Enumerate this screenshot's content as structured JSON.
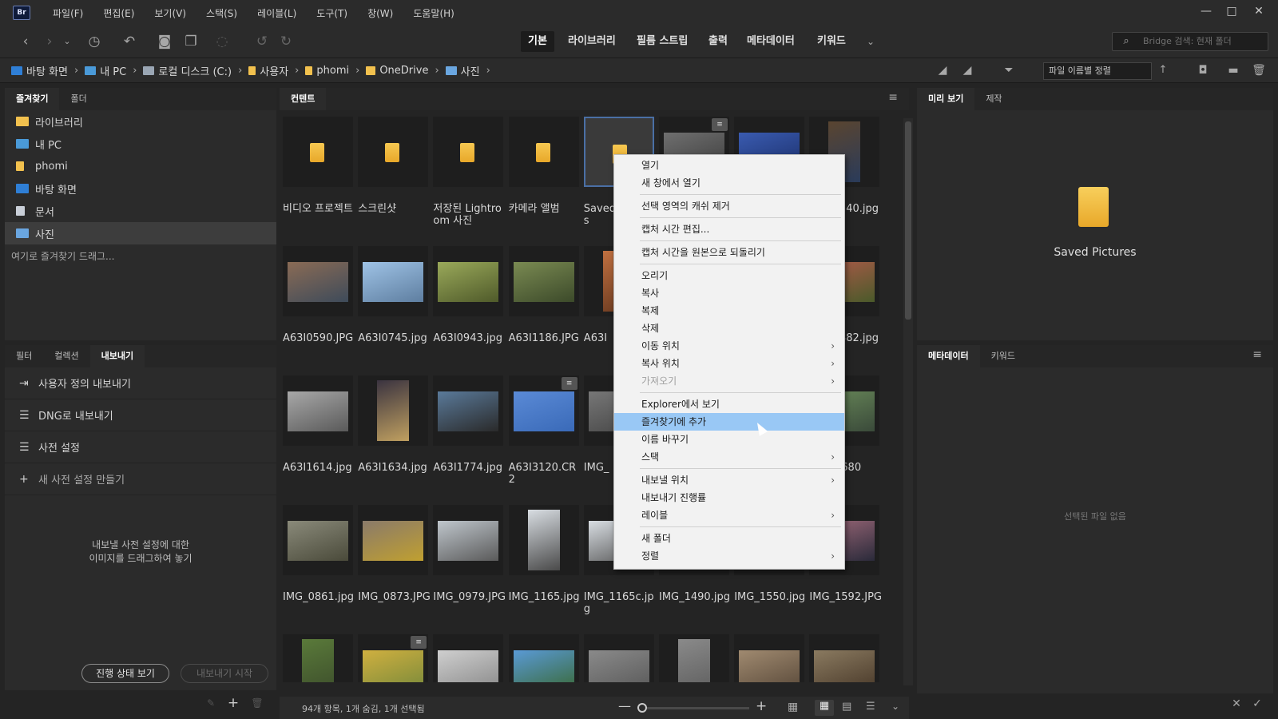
{
  "menubar": {
    "logo": "Br",
    "items": [
      "파일(F)",
      "편집(E)",
      "보기(V)",
      "스택(S)",
      "레이블(L)",
      "도구(T)",
      "창(W)",
      "도움말(H)"
    ]
  },
  "window": {
    "minimize": "—",
    "maximize": "□",
    "close": "✕"
  },
  "workspaces": [
    "기본",
    "라이브러리",
    "필름 스트립",
    "출력",
    "메타데이터",
    "키워드"
  ],
  "search": {
    "placeholder": "Bridge 검색: 현재 폴더"
  },
  "path": [
    {
      "label": "바탕 화면",
      "color": "#2f7fd6"
    },
    {
      "label": "내 PC",
      "color": "#4a9ad8"
    },
    {
      "label": "로컬 디스크 (C:)",
      "color": "#9aa6b4"
    },
    {
      "label": "사용자",
      "color": "#f2c14e"
    },
    {
      "label": "phomi",
      "color": "#f2c14e"
    },
    {
      "label": "OneDrive",
      "color": "#f2c14e"
    },
    {
      "label": "사진",
      "color": "#6aa6e0"
    }
  ],
  "sort": {
    "label": "파일 이름별 정렬"
  },
  "left_top": {
    "tabs": [
      "즐겨찾기",
      "폴더"
    ],
    "items": [
      {
        "label": "라이브러리",
        "color": "#f2c14e"
      },
      {
        "label": "내 PC",
        "color": "#4a9ad8"
      },
      {
        "label": "phomi",
        "color": "#f2c14e"
      },
      {
        "label": "바탕 화면",
        "color": "#2f7fd6"
      },
      {
        "label": "문서",
        "color": "#c9cfd8"
      },
      {
        "label": "사진",
        "color": "#6aa6e0"
      }
    ],
    "drop_hint": "여기로 즐겨찾기 드래그..."
  },
  "left_bottom": {
    "tabs": [
      "필터",
      "컬렉션",
      "내보내기"
    ],
    "items": [
      {
        "icon": "⇥",
        "label": "사용자 정의 내보내기"
      },
      {
        "icon": "☰",
        "label": "DNG로 내보내기"
      },
      {
        "icon": "☰",
        "label": "사전 설정"
      },
      {
        "icon": "+",
        "label": "새 사전 설정 만들기"
      }
    ],
    "drop_hint_1": "내보낼 사전 설정에 대한",
    "drop_hint_2": "이미지를 드래그하여 놓기",
    "progress_button": "진행 상태 보기",
    "start_button": "내보내기 시작"
  },
  "content": {
    "tab": "컨텐트",
    "cells": [
      {
        "caption": "비디오 프로젝트",
        "type": "folder"
      },
      {
        "caption": "스크린샷",
        "type": "folder"
      },
      {
        "caption": "저장된 Lightroom 사진",
        "type": "folder"
      },
      {
        "caption": "카메라 앨범",
        "type": "folder"
      },
      {
        "caption": "Saved Pictures",
        "type": "folder",
        "selected": true
      },
      {
        "caption": "",
        "type": "image",
        "colors": [
          "#6f6f6f",
          "#3d3d3d"
        ],
        "badge": "≡"
      },
      {
        "caption": "",
        "type": "image",
        "colors": [
          "#3a5bb0",
          "#1b2f6a"
        ]
      },
      {
        "caption": "A63I0540.jpg",
        "type": "image",
        "colors": [
          "#5a4530",
          "#2a3b5a"
        ]
      },
      {
        "caption": "A63I0590.JPG",
        "type": "image",
        "colors": [
          "#8a6b55",
          "#3e4b5a"
        ]
      },
      {
        "caption": "A63I0745.jpg",
        "type": "image",
        "colors": [
          "#9fc3e6",
          "#5e7ea0"
        ]
      },
      {
        "caption": "A63I0943.jpg",
        "type": "image",
        "colors": [
          "#9aa95a",
          "#4f5a2a"
        ]
      },
      {
        "caption": "A63I1186.JPG",
        "type": "image",
        "colors": [
          "#7a8a52",
          "#3c4a2a"
        ]
      },
      {
        "caption": "A63I",
        "type": "image",
        "colors": [
          "#c07040",
          "#6a3a20"
        ]
      },
      {
        "caption": "",
        "type": "image",
        "colors": [
          "#555",
          "#333"
        ]
      },
      {
        "caption": "",
        "type": "image",
        "colors": [
          "#555",
          "#333"
        ]
      },
      {
        "caption": "A63I1482.jpg",
        "type": "image",
        "colors": [
          "#b05a4a",
          "#4a5a2a"
        ]
      },
      {
        "caption": "A63I1614.jpg",
        "type": "image",
        "colors": [
          "#a8a8a8",
          "#5a5a5a"
        ]
      },
      {
        "caption": "A63I1634.jpg",
        "type": "image",
        "colors": [
          "#3a3340",
          "#c0a060"
        ]
      },
      {
        "caption": "A63I1774.jpg",
        "type": "image",
        "colors": [
          "#5a7a9a",
          "#2a2a2a"
        ]
      },
      {
        "caption": "A63I3120.CR2",
        "type": "image",
        "colors": [
          "#5a8ad6",
          "#3a6ab8"
        ],
        "badge": "≡"
      },
      {
        "caption": "IMG_",
        "type": "image",
        "colors": [
          "#777",
          "#444"
        ]
      },
      {
        "caption": "",
        "type": "image",
        "colors": [
          "#555",
          "#333"
        ]
      },
      {
        "caption": "",
        "type": "image",
        "colors": [
          "#555",
          "#333"
        ]
      },
      {
        "caption": "IMG_0680",
        "type": "image",
        "colors": [
          "#6a8a5a",
          "#3a4a3a"
        ]
      },
      {
        "caption": "IMG_0861.jpg",
        "type": "image",
        "colors": [
          "#8a8a7a",
          "#4a4a3a"
        ]
      },
      {
        "caption": "IMG_0873.JPG",
        "type": "image",
        "colors": [
          "#8a7a6a",
          "#c0a030"
        ]
      },
      {
        "caption": "IMG_0979.JPG",
        "type": "image",
        "colors": [
          "#bfc6cc",
          "#5a5a5a"
        ]
      },
      {
        "caption": "IMG_1165.jpg",
        "type": "image",
        "colors": [
          "#d8dde2",
          "#4a4a4a"
        ]
      },
      {
        "caption": "IMG_1165c.jpg",
        "type": "image",
        "colors": [
          "#d8dde2",
          "#555"
        ]
      },
      {
        "caption": "IMG_1490.jpg",
        "type": "image",
        "colors": [
          "#555",
          "#333"
        ]
      },
      {
        "caption": "IMG_1550.jpg",
        "type": "image",
        "colors": [
          "#555",
          "#333"
        ]
      },
      {
        "caption": "IMG_1592.JPG",
        "type": "image",
        "colors": [
          "#a06a7a",
          "#2a2a3a"
        ]
      },
      {
        "caption": "",
        "type": "image",
        "colors": [
          "#5a7a3a",
          "#3a4a2a"
        ]
      },
      {
        "caption": "",
        "type": "image",
        "colors": [
          "#d0b040",
          "#7a8a3a"
        ],
        "badge": "≡"
      },
      {
        "caption": "",
        "type": "image",
        "colors": [
          "#cfcfcf",
          "#8a8a8a"
        ]
      },
      {
        "caption": "",
        "type": "image",
        "colors": [
          "#5a9ad6",
          "#3a6a3a"
        ]
      },
      {
        "caption": "",
        "type": "image",
        "colors": [
          "#8a8a8a",
          "#5a5a5a"
        ]
      },
      {
        "caption": "",
        "type": "image",
        "colors": [
          "#8a8a8a",
          "#5a5a5a"
        ]
      },
      {
        "caption": "",
        "type": "image",
        "colors": [
          "#a08a70",
          "#5a4a3a"
        ]
      },
      {
        "caption": "",
        "type": "image",
        "colors": [
          "#8a7a60",
          "#4a3a2a"
        ]
      }
    ]
  },
  "context_menu": {
    "items": [
      {
        "label": "열기"
      },
      {
        "label": "새 창에서 열기"
      },
      {
        "sep": true
      },
      {
        "label": "선택 영역의 캐쉬 제거"
      },
      {
        "sep": true
      },
      {
        "label": "캡처 시간 편집..."
      },
      {
        "sep": true
      },
      {
        "label": "캡처 시간을 원본으로 되돌리기"
      },
      {
        "sep": true
      },
      {
        "label": "오리기"
      },
      {
        "label": "복사"
      },
      {
        "label": "복제"
      },
      {
        "label": "삭제"
      },
      {
        "label": "이동 위치",
        "submenu": true
      },
      {
        "label": "복사 위치",
        "submenu": true
      },
      {
        "label": "가져오기",
        "submenu": true,
        "disabled": true
      },
      {
        "sep": true
      },
      {
        "label": "Explorer에서 보기"
      },
      {
        "label": "즐겨찾기에 추가",
        "highlighted": true
      },
      {
        "label": "이름 바꾸기"
      },
      {
        "label": "스택",
        "submenu": true
      },
      {
        "sep": true
      },
      {
        "label": "내보낼 위치",
        "submenu": true
      },
      {
        "label": "내보내기 진행률"
      },
      {
        "label": "레이블",
        "submenu": true
      },
      {
        "sep": true
      },
      {
        "label": "새 폴더"
      },
      {
        "label": "정렬",
        "submenu": true
      }
    ]
  },
  "preview": {
    "tabs": [
      "미리 보기",
      "제작"
    ],
    "caption": "Saved Pictures"
  },
  "metadata": {
    "tabs": [
      "메타데이터",
      "키워드"
    ],
    "empty": "선택된 파일 없음"
  },
  "status": {
    "text": "94개 항목, 1개 숨김, 1개 선택됨"
  },
  "icons": {
    "panel_menu": "≡",
    "minus": "—",
    "plus": "+"
  }
}
